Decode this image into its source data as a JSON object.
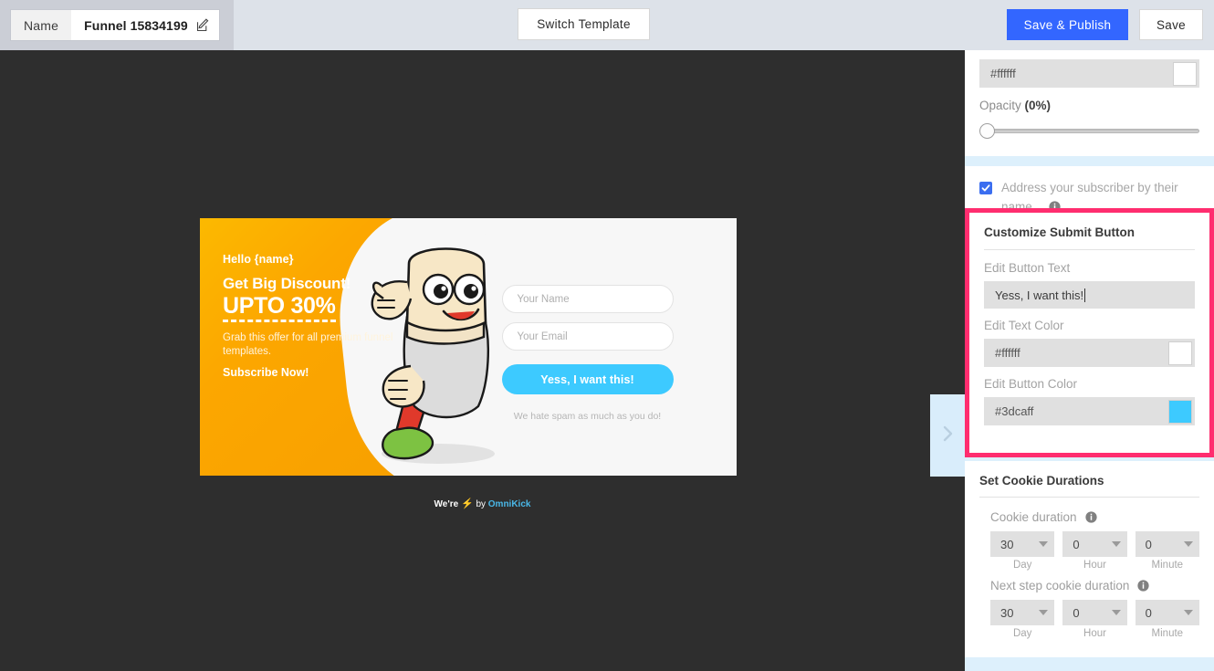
{
  "topbar": {
    "name_label": "Name",
    "funnel_name": "Funnel 15834199",
    "edit_icon": "edit-pencil-icon",
    "switch_template": "Switch Template",
    "save_publish": "Save & Publish",
    "save": "Save",
    "publish_color": "#3366ff"
  },
  "canvas": {
    "popup": {
      "hello": "Hello {name}",
      "headline": "Get Big Discount!",
      "upto": "UPTO 30%",
      "subcopy": "Grab this offer for all premium funnel templates.",
      "subscribe": "Subscribe Now!",
      "name_placeholder": "Your Name",
      "email_placeholder": "Your Email",
      "submit_label": "Yess, I want this!",
      "submit_color": "#3dcaff",
      "submit_text_color": "#ffffff",
      "spam_note": "We hate spam as much as you do!"
    },
    "brandline": {
      "prefix": "We're",
      "bolt": "⚡",
      "by": "by",
      "brand": "OmniKick"
    },
    "collapse_handle_icon": "chevron-right-icon"
  },
  "sidebar": {
    "background_color": {
      "hex": "#ffffff",
      "swatch": "#ffffff"
    },
    "opacity": {
      "label": "Opacity",
      "value": "(0%)",
      "percent": 0
    },
    "address_subscriber": {
      "label": "Address your subscriber by their name",
      "checked": true,
      "info_icon": "info-icon"
    },
    "customize_submit": {
      "title": "Customize Submit Button",
      "button_text_label": "Edit Button Text",
      "button_text_value": "Yess, I want this!",
      "text_color_label": "Edit Text Color",
      "text_color_value": "#ffffff",
      "button_color_label": "Edit Button Color",
      "button_color_value": "#3dcaff",
      "highlight_color": "#ff2d6f"
    },
    "cookie_durations": {
      "title": "Set Cookie Durations",
      "cookie_duration_label": "Cookie duration",
      "next_step_label": "Next step cookie duration",
      "units": [
        "Day",
        "Hour",
        "Minute"
      ],
      "cookie_duration_values": [
        "30",
        "0",
        "0"
      ],
      "next_step_values": [
        "30",
        "0",
        "0"
      ],
      "info_icon": "info-icon"
    }
  }
}
